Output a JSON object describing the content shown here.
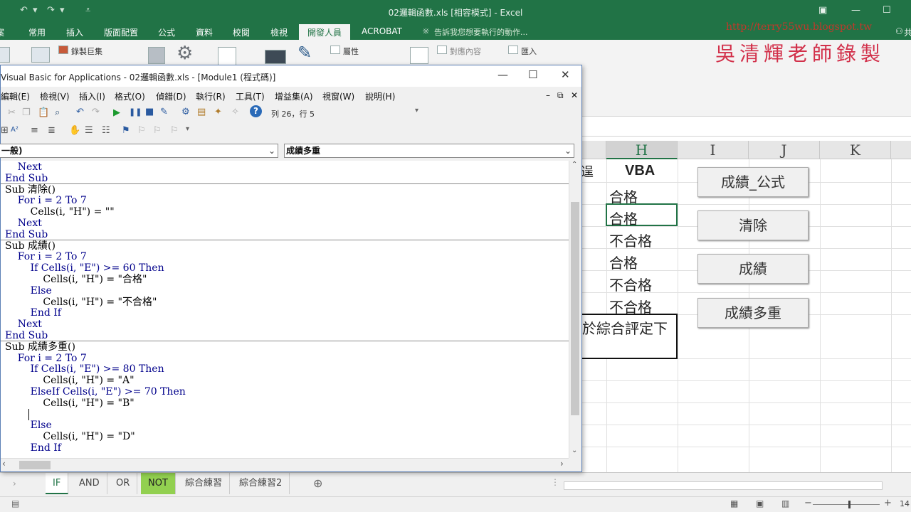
{
  "excel": {
    "title": "02邏輯函數.xls [相容模式] - Excel",
    "tabs": [
      "案",
      "常用",
      "插入",
      "版面配置",
      "公式",
      "資料",
      "校閱",
      "檢視",
      "開發人員",
      "ACROBAT"
    ],
    "active_tab": "開發人員",
    "tell_me": "告訴我您想要執行的動作...",
    "share": "共",
    "ribbon": {
      "record_macro": "錄製巨集",
      "properties": "屬性",
      "map_properties": "對應內容",
      "import": "匯入"
    },
    "watermark_url": "http://terry55wu.blogspot.tw",
    "watermark_name": "吳清輝老師錄製",
    "columns": [
      "H",
      "I",
      "J",
      "K"
    ],
    "selected_column": "H",
    "h_header": "VBA",
    "h_values": [
      "合格",
      "合格",
      "不合格",
      "合格",
      "不合格",
      "不合格"
    ],
    "partial_cell": "於綜合評定下",
    "partial_g": "逞",
    "buttons": [
      "成績_公式",
      "清除",
      "成績",
      "成績多重"
    ],
    "sheet_tabs": [
      "IF",
      "AND",
      "OR",
      "NOT",
      "綜合練習",
      "綜合練習2"
    ],
    "active_sheet": "IF",
    "green_sheet": "NOT",
    "zoom": "14"
  },
  "vba": {
    "title": "Visual Basic for Applications - 02邏輯函數.xls - [Module1 (程式碼)]",
    "menu": [
      "編輯(E)",
      "檢視(V)",
      "插入(I)",
      "格式(O)",
      "偵錯(D)",
      "執行(R)",
      "工具(T)",
      "增益集(A)",
      "視窗(W)",
      "說明(H)"
    ],
    "position": "列 26，行 5",
    "object_combo": "一般)",
    "proc_combo": "成績多重",
    "code_lines": [
      {
        "text": "    Next",
        "kw": true
      },
      {
        "text": "End Sub",
        "kw": true
      },
      {
        "text": "Sub 清除()",
        "kw": false,
        "sep": true
      },
      {
        "text": "    For i = 2 To 7",
        "kw": true
      },
      {
        "text": "        Cells(i, \"H\") = \"\"",
        "kw": false
      },
      {
        "text": "    Next",
        "kw": true
      },
      {
        "text": "End Sub",
        "kw": true
      },
      {
        "text": "Sub 成績()",
        "kw": false,
        "sep": true
      },
      {
        "text": "    For i = 2 To 7",
        "kw": true
      },
      {
        "text": "        If Cells(i, \"E\") >= 60 Then",
        "kw": true
      },
      {
        "text": "            Cells(i, \"H\") = \"合格\"",
        "kw": false
      },
      {
        "text": "        Else",
        "kw": true
      },
      {
        "text": "            Cells(i, \"H\") = \"不合格\"",
        "kw": false
      },
      {
        "text": "        End If",
        "kw": true
      },
      {
        "text": "    Next",
        "kw": true
      },
      {
        "text": "End Sub",
        "kw": true
      },
      {
        "text": "Sub 成績多重()",
        "kw": false,
        "sep": true
      },
      {
        "text": "    For i = 2 To 7",
        "kw": true
      },
      {
        "text": "        If Cells(i, \"E\") >= 80 Then",
        "kw": true
      },
      {
        "text": "            Cells(i, \"H\") = \"A\"",
        "kw": false
      },
      {
        "text": "        ElseIf Cells(i, \"E\") >= 70 Then",
        "kw": true
      },
      {
        "text": "            Cells(i, \"H\") = \"B\"",
        "kw": false
      },
      {
        "text": "",
        "kw": false,
        "caret": true
      },
      {
        "text": "        Else",
        "kw": true
      },
      {
        "text": "            Cells(i, \"H\") = \"D\"",
        "kw": false
      },
      {
        "text": "        End If",
        "kw": true
      }
    ]
  }
}
